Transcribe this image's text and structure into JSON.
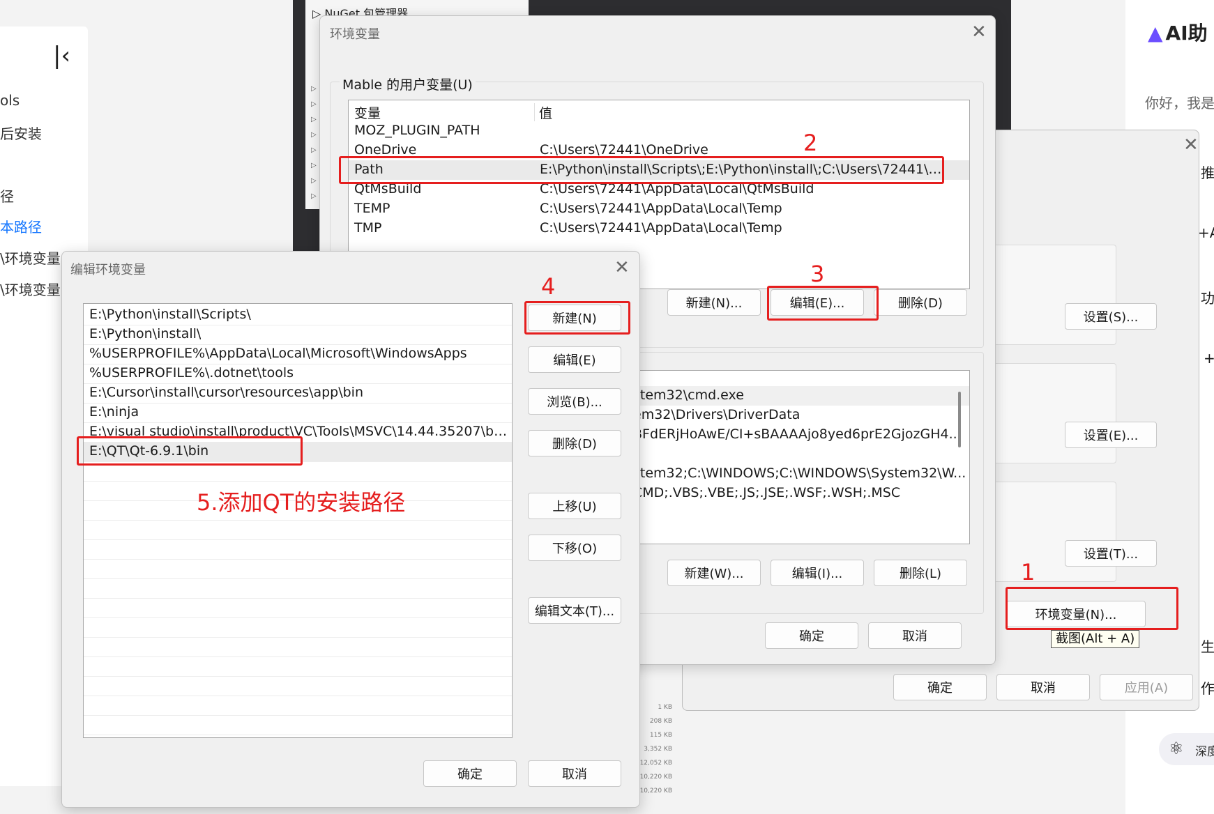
{
  "blog_sidebar": {
    "items": [
      "ols",
      "后安装",
      "径",
      "本路径",
      "\\环境变量",
      "\\环境变量"
    ],
    "active_index": 3
  },
  "ai_panel": {
    "title": "AI助",
    "greeting": "你好，我是",
    "deep_label": "深度"
  },
  "vs": {
    "nuget": "NuGet 包管理器"
  },
  "system_properties": {
    "buttons": {
      "settings_s": "设置(S)...",
      "settings_e": "设置(E)...",
      "settings_t": "设置(T)...",
      "env_vars": "环境变量(N)...",
      "ok": "确定",
      "cancel": "取消",
      "apply": "应用(A)"
    },
    "side_fragments": [
      "推",
      "+A",
      "功",
      "+",
      "生",
      "作"
    ]
  },
  "tooltip": "截图(Alt + A)",
  "env_dialog": {
    "title": "环境变量",
    "user_group_label": "Mable 的用户变量(U)",
    "columns": {
      "name": "变量",
      "value": "值"
    },
    "user_vars": [
      {
        "name": "MOZ_PLUGIN_PATH",
        "value": ""
      },
      {
        "name": "OneDrive",
        "value": "C:\\Users\\72441\\OneDrive"
      },
      {
        "name": "Path",
        "value": "E:\\Python\\install\\Scripts\\;E:\\Python\\install\\;C:\\Users\\72441\\AppDa..."
      },
      {
        "name": "QtMsBuild",
        "value": "C:\\Users\\72441\\AppData\\Local\\QtMsBuild"
      },
      {
        "name": "TEMP",
        "value": "C:\\Users\\72441\\AppData\\Local\\Temp"
      },
      {
        "name": "TMP",
        "value": "C:\\Users\\72441\\AppData\\Local\\Temp"
      }
    ],
    "selected_user_var": 2,
    "user_buttons": {
      "new": "新建(N)...",
      "edit": "编辑(E)...",
      "delete": "删除(D)"
    },
    "system_vars_visible": [
      "stem32\\cmd.exe",
      "em32\\Drivers\\DriverData",
      "BFdERjHoAwE/CI+sBAAAAjo8yed6prE2GjozGH4...",
      "",
      "stem32;C:\\WINDOWS;C:\\WINDOWS\\System32\\W...",
      "CMD;.VBS;.VBE;.JS;.JSE;.WSF;.WSH;.MSC"
    ],
    "system_buttons": {
      "new": "新建(W)...",
      "edit": "编辑(I)...",
      "delete": "删除(L)"
    },
    "ok": "确定",
    "cancel": "取消"
  },
  "edit_dialog": {
    "title": "编辑环境变量",
    "entries": [
      "E:\\Python\\install\\Scripts\\",
      "E:\\Python\\install\\",
      "%USERPROFILE%\\AppData\\Local\\Microsoft\\WindowsApps",
      "%USERPROFILE%\\.dotnet\\tools",
      "E:\\Cursor\\install\\cursor\\resources\\app\\bin",
      "E:\\ninja",
      "E:\\visual studio\\install\\product\\VC\\Tools\\MSVC\\14.44.35207\\bin\\Ho...",
      "E:\\QT\\Qt-6.9.1\\bin"
    ],
    "selected_index": 7,
    "buttons": {
      "new": "新建(N)",
      "edit": "编辑(E)",
      "browse": "浏览(B)...",
      "delete": "删除(D)",
      "move_up": "上移(U)",
      "move_down": "下移(O)",
      "edit_text": "编辑文本(T)..."
    },
    "ok": "确定",
    "cancel": "取消"
  },
  "annotations": {
    "step1": "1",
    "step2": "2",
    "step3": "3",
    "step4": "4",
    "step5": "5.添加QT的安装路径",
    "color": "#e51e1e"
  },
  "file_sizes": [
    "1 KB",
    "208 KB",
    "115 KB",
    "3,352 KB",
    "12,052 KB",
    "10,220 KB",
    "10,220 KB"
  ]
}
